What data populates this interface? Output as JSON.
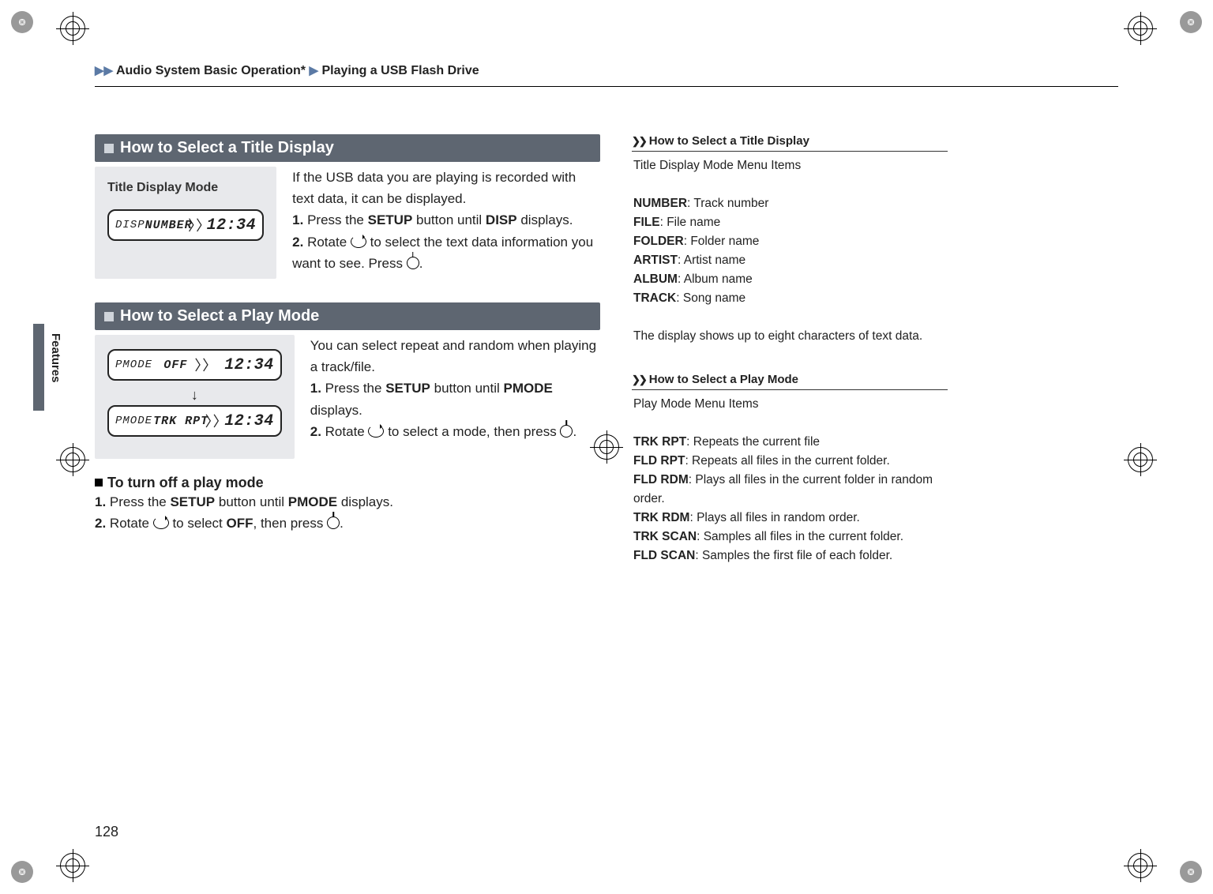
{
  "breadcrumb": {
    "level1_pre": "▶▶",
    "level1": "Audio System Basic Operation*",
    "sep": "▶",
    "level2": "Playing a USB Flash Drive"
  },
  "side_tab": "Features",
  "page_number": "128",
  "section1": {
    "title": "How to Select a Title Display",
    "img_label": "Title Display Mode",
    "lcd": {
      "left": "DISP",
      "mid": "NUMBER",
      "time": "12:34"
    },
    "p_intro1": "If the USB data you are playing is recorded with text data, it can be displayed.",
    "step1_num": "1.",
    "step1_a": "Press the ",
    "step1_b": "SETUP",
    "step1_c": " button until ",
    "step1_d": "DISP",
    "step1_e": " displays.",
    "step2_num": "2.",
    "step2_a": "Rotate ",
    "step2_b": " to select the text data information you want to see. Press ",
    "step2_c": "."
  },
  "section2": {
    "title": "How to Select a Play Mode",
    "lcd1": {
      "left": "PMODE",
      "mid": "OFF",
      "time": "12:34"
    },
    "lcd2": {
      "left": "PMODE",
      "mid": "TRK  RPT",
      "time": "12:34"
    },
    "p_intro": "You can select repeat and random when playing a track/file.",
    "step1_num": "1.",
    "step1_a": "Press the ",
    "step1_b": "SETUP",
    "step1_c": " button until ",
    "step1_d": "PMODE",
    "step1_e": " displays.",
    "step2_num": "2.",
    "step2_a": "Rotate ",
    "step2_b": " to select a mode, then press ",
    "step2_c": "."
  },
  "section3": {
    "title": "To turn off a play mode",
    "step1_num": "1.",
    "step1_a": "Press the ",
    "step1_b": "SETUP",
    "step1_c": " button until ",
    "step1_d": "PMODE",
    "step1_e": " displays.",
    "step2_num": "2.",
    "step2_a": "Rotate ",
    "step2_b": " to select ",
    "step2_c": "OFF",
    "step2_d": ", then press ",
    "step2_e": "."
  },
  "side1": {
    "title": "How to Select a Title Display",
    "intro": "Title Display Mode Menu Items",
    "items": [
      {
        "k": "NUMBER",
        "v": ": Track number"
      },
      {
        "k": "FILE",
        "v": ": File name"
      },
      {
        "k": "FOLDER",
        "v": ": Folder name"
      },
      {
        "k": "ARTIST",
        "v": ": Artist name"
      },
      {
        "k": "ALBUM",
        "v": ": Album name"
      },
      {
        "k": "TRACK",
        "v": ": Song name"
      }
    ],
    "note": "The display shows up to eight characters of text data."
  },
  "side2": {
    "title": "How to Select a Play Mode",
    "intro": "Play Mode Menu Items",
    "items": [
      {
        "k": "TRK RPT",
        "v": ": Repeats the current file"
      },
      {
        "k": "FLD RPT",
        "v": ": Repeats all files in the current folder."
      },
      {
        "k": "FLD RDM",
        "v": ": Plays all files in the current folder in random order."
      },
      {
        "k": "TRK RDM",
        "v": ": Plays all files in random order."
      },
      {
        "k": "TRK SCAN",
        "v": ": Samples all files in the current folder."
      },
      {
        "k": "FLD SCAN",
        "v": ": Samples the first file of each folder."
      }
    ]
  }
}
